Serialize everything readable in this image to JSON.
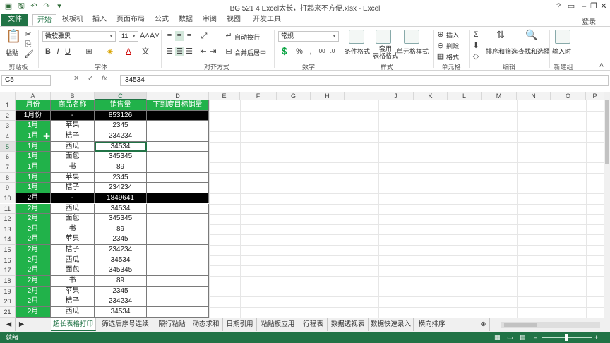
{
  "window": {
    "title": "BG 521 4 Excel太长，打起来不方便.xlsx - Excel"
  },
  "tabs": [
    "文件",
    "开始",
    "插入",
    "页面布局",
    "公式",
    "数据",
    "审阅",
    "视图",
    "开发工具"
  ],
  "tab_extra": "模板机",
  "login_label": "登录",
  "ribbon": {
    "clipboard": {
      "paste": "粘贴",
      "label": "剪贴板"
    },
    "font": {
      "name": "微软雅黑",
      "size": "11",
      "label": "字体"
    },
    "alignment": {
      "wrap": "自动换行",
      "merge": "合并后居中",
      "label": "对齐方式"
    },
    "number": {
      "format": "常规",
      "label": "数字"
    },
    "styles": {
      "cond": "条件格式",
      "table": "套用\n表格格式",
      "cellstyle": "单元格样式",
      "label": "样式"
    },
    "cells": {
      "insert": "插入",
      "delete": "删除",
      "format": "格式",
      "label": "单元格"
    },
    "editing": {
      "sort": "排序和筛选",
      "find": "查找和选择",
      "label": "编辑"
    },
    "newgroup": {
      "input": "输入时",
      "label": "新建组"
    }
  },
  "formula_bar": {
    "name_box": "C5",
    "fx": "fx",
    "value": "34534"
  },
  "columns": [
    "A",
    "B",
    "C",
    "D",
    "E",
    "F",
    "G",
    "H",
    "I",
    "J",
    "K",
    "L",
    "M",
    "N",
    "O",
    "P"
  ],
  "header_row": [
    "月份",
    "商品名称",
    "销售量",
    "下到度目标销量"
  ],
  "rows": [
    {
      "r": "2",
      "a": "1月份",
      "b": "-",
      "c": "853126",
      "type": "summary"
    },
    {
      "r": "3",
      "a": "1月",
      "b": "苹果",
      "c": "2345",
      "type": "data"
    },
    {
      "r": "4",
      "a": "1月",
      "b": "桔子",
      "c": "234234",
      "type": "data"
    },
    {
      "r": "5",
      "a": "1月",
      "b": "西瓜",
      "c": "34534",
      "type": "data"
    },
    {
      "r": "6",
      "a": "1月",
      "b": "面包",
      "c": "345345",
      "type": "data"
    },
    {
      "r": "7",
      "a": "1月",
      "b": "书",
      "c": "89",
      "type": "data"
    },
    {
      "r": "8",
      "a": "1月",
      "b": "苹果",
      "c": "2345",
      "type": "data"
    },
    {
      "r": "9",
      "a": "1月",
      "b": "桔子",
      "c": "234234",
      "type": "data"
    },
    {
      "r": "10",
      "a": "2月",
      "b": "-",
      "c": "1849641",
      "type": "summary"
    },
    {
      "r": "11",
      "a": "2月",
      "b": "西瓜",
      "c": "34534",
      "type": "data"
    },
    {
      "r": "12",
      "a": "2月",
      "b": "面包",
      "c": "345345",
      "type": "data"
    },
    {
      "r": "13",
      "a": "2月",
      "b": "书",
      "c": "89",
      "type": "data"
    },
    {
      "r": "14",
      "a": "2月",
      "b": "苹果",
      "c": "2345",
      "type": "data"
    },
    {
      "r": "15",
      "a": "2月",
      "b": "桔子",
      "c": "234234",
      "type": "data"
    },
    {
      "r": "16",
      "a": "2月",
      "b": "西瓜",
      "c": "34534",
      "type": "data"
    },
    {
      "r": "17",
      "a": "2月",
      "b": "面包",
      "c": "345345",
      "type": "data"
    },
    {
      "r": "18",
      "a": "2月",
      "b": "书",
      "c": "89",
      "type": "data"
    },
    {
      "r": "19",
      "a": "2月",
      "b": "苹果",
      "c": "2345",
      "type": "data"
    },
    {
      "r": "20",
      "a": "2月",
      "b": "桔子",
      "c": "234234",
      "type": "data"
    },
    {
      "r": "21",
      "a": "2月",
      "b": "西瓜",
      "c": "34534",
      "type": "data"
    }
  ],
  "sheets": [
    "超长表格打印",
    "筛选后序号连续",
    "隔行粘贴",
    "动态求和",
    "日期引用",
    "粘贴板应用",
    "行程表",
    "数据透视表",
    "数据快速录入",
    "横向排序"
  ],
  "status": {
    "left": "就绪"
  },
  "colors": {
    "accent": "#217346",
    "header_fill": "#21b24a",
    "summary_fill": "#000000"
  }
}
